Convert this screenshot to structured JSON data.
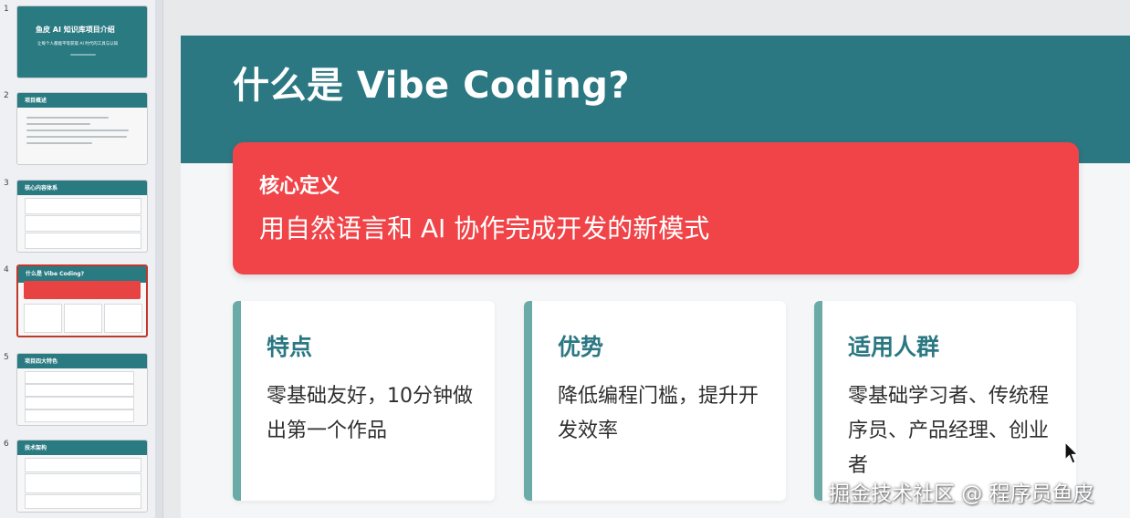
{
  "thumbnails": [
    {
      "number": "1",
      "title": "鱼皮 AI 知识库项目介绍",
      "subtitle": "让每个人都能平等获取 AI 时代的工具与认知"
    },
    {
      "number": "2",
      "title": "项目概述"
    },
    {
      "number": "3",
      "title": "核心内容体系"
    },
    {
      "number": "4",
      "title": "什么是 Vibe Coding?",
      "selected": true
    },
    {
      "number": "5",
      "title": "项目四大特色"
    },
    {
      "number": "6",
      "title": "技术架构"
    }
  ],
  "slide": {
    "title": "什么是 Vibe Coding?",
    "core": {
      "label": "核心定义",
      "text": "用自然语言和 AI 协作完成开发的新模式"
    },
    "features": [
      {
        "title": "特点",
        "body": "零基础友好，10分钟做出第一个作品"
      },
      {
        "title": "优势",
        "body": "降低编程门槛，提升开发效率"
      },
      {
        "title": "适用人群",
        "body": "零基础学习者、传统程序员、产品经理、创业者"
      }
    ]
  },
  "watermark": "掘金技术社区 @ 程序员鱼皮",
  "colors": {
    "teal": "#2b7883",
    "red": "#f04448",
    "accent_bar": "#6aaba7",
    "selected_border": "#c0392b"
  }
}
